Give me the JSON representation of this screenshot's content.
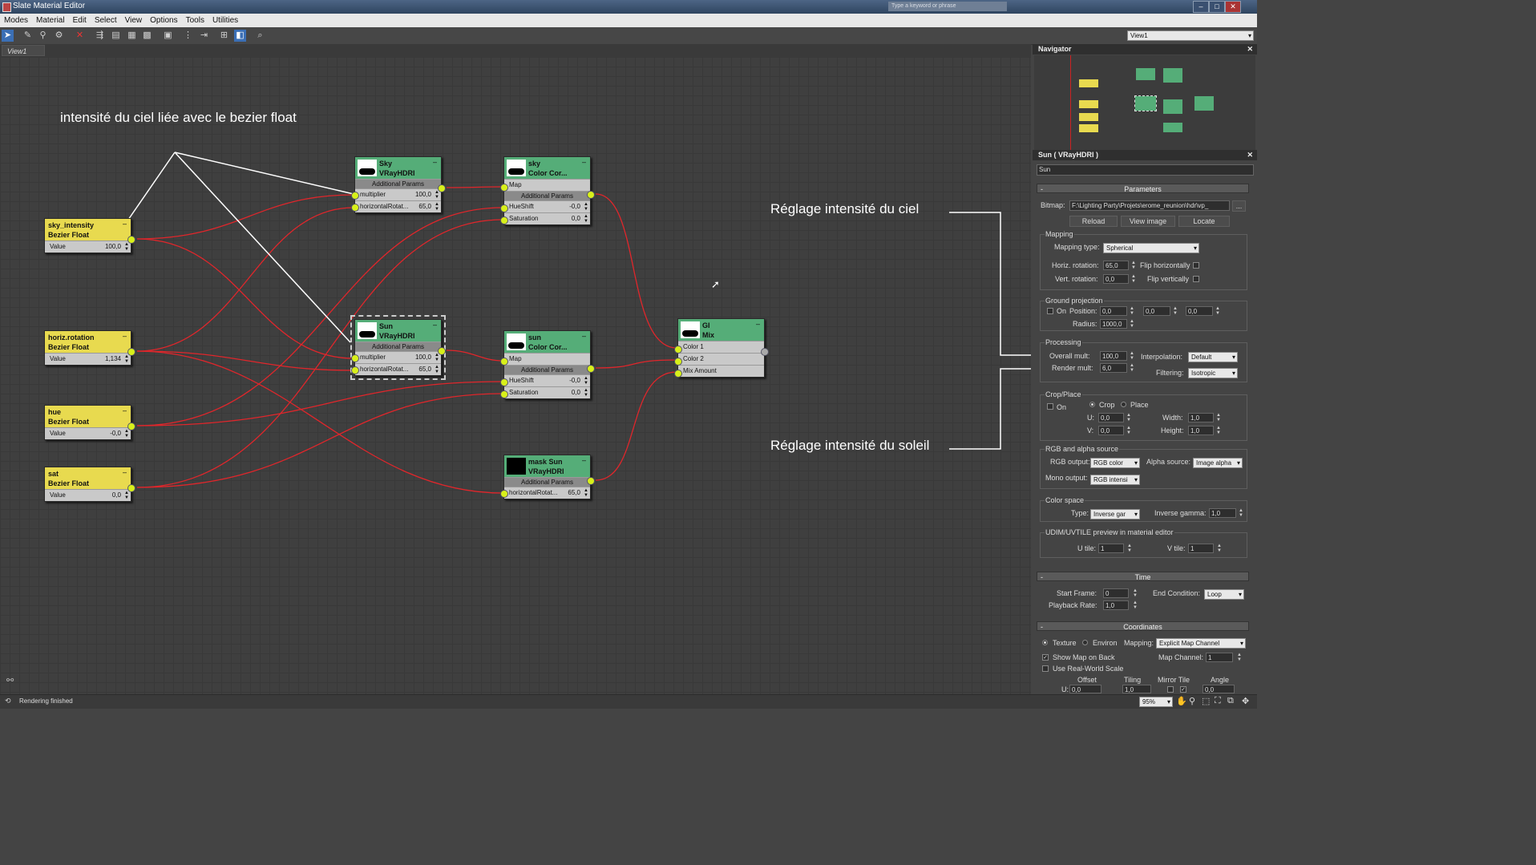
{
  "window": {
    "title": "Slate Material Editor",
    "search_placeholder": "Type a keyword or phrase"
  },
  "menu": [
    "Modes",
    "Material",
    "Edit",
    "Select",
    "View",
    "Options",
    "Tools",
    "Utilities"
  ],
  "toolbar": {
    "icons": [
      "select-tool-icon",
      "pick-material-icon",
      "put-to-scene-icon",
      "assign-to-selection-icon",
      "delete-icon",
      "move-children-icon",
      "hide-unused-icon",
      "background-icon",
      "show-map-icon",
      "show-end-result-icon",
      "layout-all-icon",
      "layout-children-icon",
      "material-map-browser-icon",
      "parameter-editor-icon",
      "select-by-material-icon"
    ],
    "view_select": "View1"
  },
  "view_tab": "View1",
  "annotations": {
    "sky_link": "intensité du ciel liée avec le bezier float",
    "sky_intensity": "Réglage intensité du ciel",
    "sun_intensity": "Réglage intensité du soleil"
  },
  "nodes": {
    "sky_intensity": {
      "title": "sky_intensity",
      "subtitle": "Bezier Float",
      "row_label": "Value",
      "row_value": "100,0"
    },
    "horiz_rotation": {
      "title": "horiz.rotation",
      "subtitle": "Bezier Float",
      "row_label": "Value",
      "row_value": "1,134"
    },
    "hue": {
      "title": "hue",
      "subtitle": "Bezier Float",
      "row_label": "Value",
      "row_value": "-0,0"
    },
    "sat": {
      "title": "sat",
      "subtitle": "Bezier Float",
      "row_label": "Value",
      "row_value": "0,0"
    },
    "sky_hdri": {
      "title": "Sky",
      "subtitle": "VRayHDRI",
      "group": "Additional Params",
      "rows": [
        {
          "label": "multiplier",
          "value": "100,0"
        },
        {
          "label": "horizontalRotat...",
          "value": "65,0"
        }
      ]
    },
    "sun_hdri": {
      "title": "Sun",
      "subtitle": "VRayHDRI",
      "group": "Additional Params",
      "rows": [
        {
          "label": "multiplier",
          "value": "100,0"
        },
        {
          "label": "horizontalRotat...",
          "value": "65,0"
        }
      ]
    },
    "sky_cc": {
      "title": "sky",
      "subtitle": "Color Cor...",
      "map": "Map",
      "group": "Additional Params",
      "rows": [
        {
          "label": "HueShift",
          "value": "-0,0"
        },
        {
          "label": "Saturation",
          "value": "0,0"
        }
      ]
    },
    "sun_cc": {
      "title": "sun",
      "subtitle": "Color Cor...",
      "map": "Map",
      "group": "Additional Params",
      "rows": [
        {
          "label": "HueShift",
          "value": "-0,0"
        },
        {
          "label": "Saturation",
          "value": "0,0"
        }
      ]
    },
    "mask_sun": {
      "title": "mask Sun",
      "subtitle": "VRayHDRI",
      "group": "Additional Params",
      "rows": [
        {
          "label": "horizontalRotat...",
          "value": "65,0"
        }
      ]
    },
    "gi_mix": {
      "title": "GI",
      "subtitle": "Mix",
      "rows": [
        "Color 1",
        "Color 2",
        "Mix Amount"
      ]
    }
  },
  "navigator": {
    "title": "Navigator"
  },
  "params": {
    "header": "Sun  ( VRayHDRI )",
    "name_field": "Sun",
    "parameters": "Parameters",
    "bitmap_label": "Bitmap:",
    "bitmap_path": "F:\\Lighting Party\\Projets\\erome_reunion\\hdr\\vp_",
    "bitmap_more": "...",
    "buttons": [
      "Reload",
      "View image",
      "Locate"
    ],
    "mapping": {
      "group": "Mapping",
      "type_label": "Mapping type:",
      "type_value": "Spherical",
      "horiz_label": "Horiz. rotation:",
      "horiz_value": "65,0",
      "flip_h": "Flip horizontally",
      "vert_label": "Vert. rotation:",
      "vert_value": "0,0",
      "flip_v": "Flip vertically"
    },
    "ground": {
      "group": "Ground projection",
      "on": "On",
      "position": "Position:",
      "pos_values": [
        "0,0",
        "0,0",
        "0,0"
      ],
      "radius_label": "Radius:",
      "radius_value": "1000,0"
    },
    "processing": {
      "group": "Processing",
      "overall_label": "Overall mult:",
      "overall_value": "100,0",
      "render_label": "Render mult:",
      "render_value": "6,0",
      "interp_label": "Interpolation:",
      "interp_value": "Default",
      "filter_label": "Filtering:",
      "filter_value": "Isotropic"
    },
    "crop": {
      "group": "Crop/Place",
      "on": "On",
      "crop": "Crop",
      "place": "Place",
      "u_label": "U:",
      "u_value": "0,0",
      "v_label": "V:",
      "v_value": "0,0",
      "w_label": "Width:",
      "w_value": "1,0",
      "h_label": "Height:",
      "h_value": "1,0"
    },
    "rgb": {
      "group": "RGB and alpha source",
      "rgb_label": "RGB output:",
      "rgb_value": "RGB color",
      "alpha_label": "Alpha source:",
      "alpha_value": "Image alpha",
      "mono_label": "Mono output:",
      "mono_value": "RGB intensi"
    },
    "colorspace": {
      "group": "Color space",
      "type_label": "Type:",
      "type_value": "Inverse gar",
      "gamma_label": "Inverse gamma:",
      "gamma_value": "1,0"
    },
    "udim": {
      "group": "UDIM/UVTILE preview in material editor",
      "u_label": "U tile:",
      "u_value": "1",
      "v_label": "V tile:",
      "v_value": "1"
    },
    "time": {
      "title": "Time",
      "start_label": "Start Frame:",
      "start_value": "0",
      "end_label": "End Condition:",
      "end_value": "Loop",
      "rate_label": "Playback Rate:",
      "rate_value": "1,0"
    },
    "coords": {
      "title": "Coordinates",
      "texture": "Texture",
      "environ": "Environ",
      "mapping_label": "Mapping:",
      "mapping_value": "Explicit Map Channel",
      "show_map": "Show Map on Back",
      "channel_label": "Map Channel:",
      "channel_value": "1",
      "real_world": "Use Real-World Scale",
      "cols": [
        "Offset",
        "Tiling",
        "Mirror Tile",
        "Angle"
      ],
      "u_label": "U:",
      "u_offset": "0,0",
      "u_tiling": "1,0",
      "u_angle": "0,0"
    }
  },
  "status": {
    "text": "Rendering finished",
    "zoom": "95%"
  },
  "colors": {
    "wire": "#e0262b",
    "bezier_node": "#e8da4f",
    "map_node": "#55ad78",
    "socket": "#d8f01a"
  }
}
